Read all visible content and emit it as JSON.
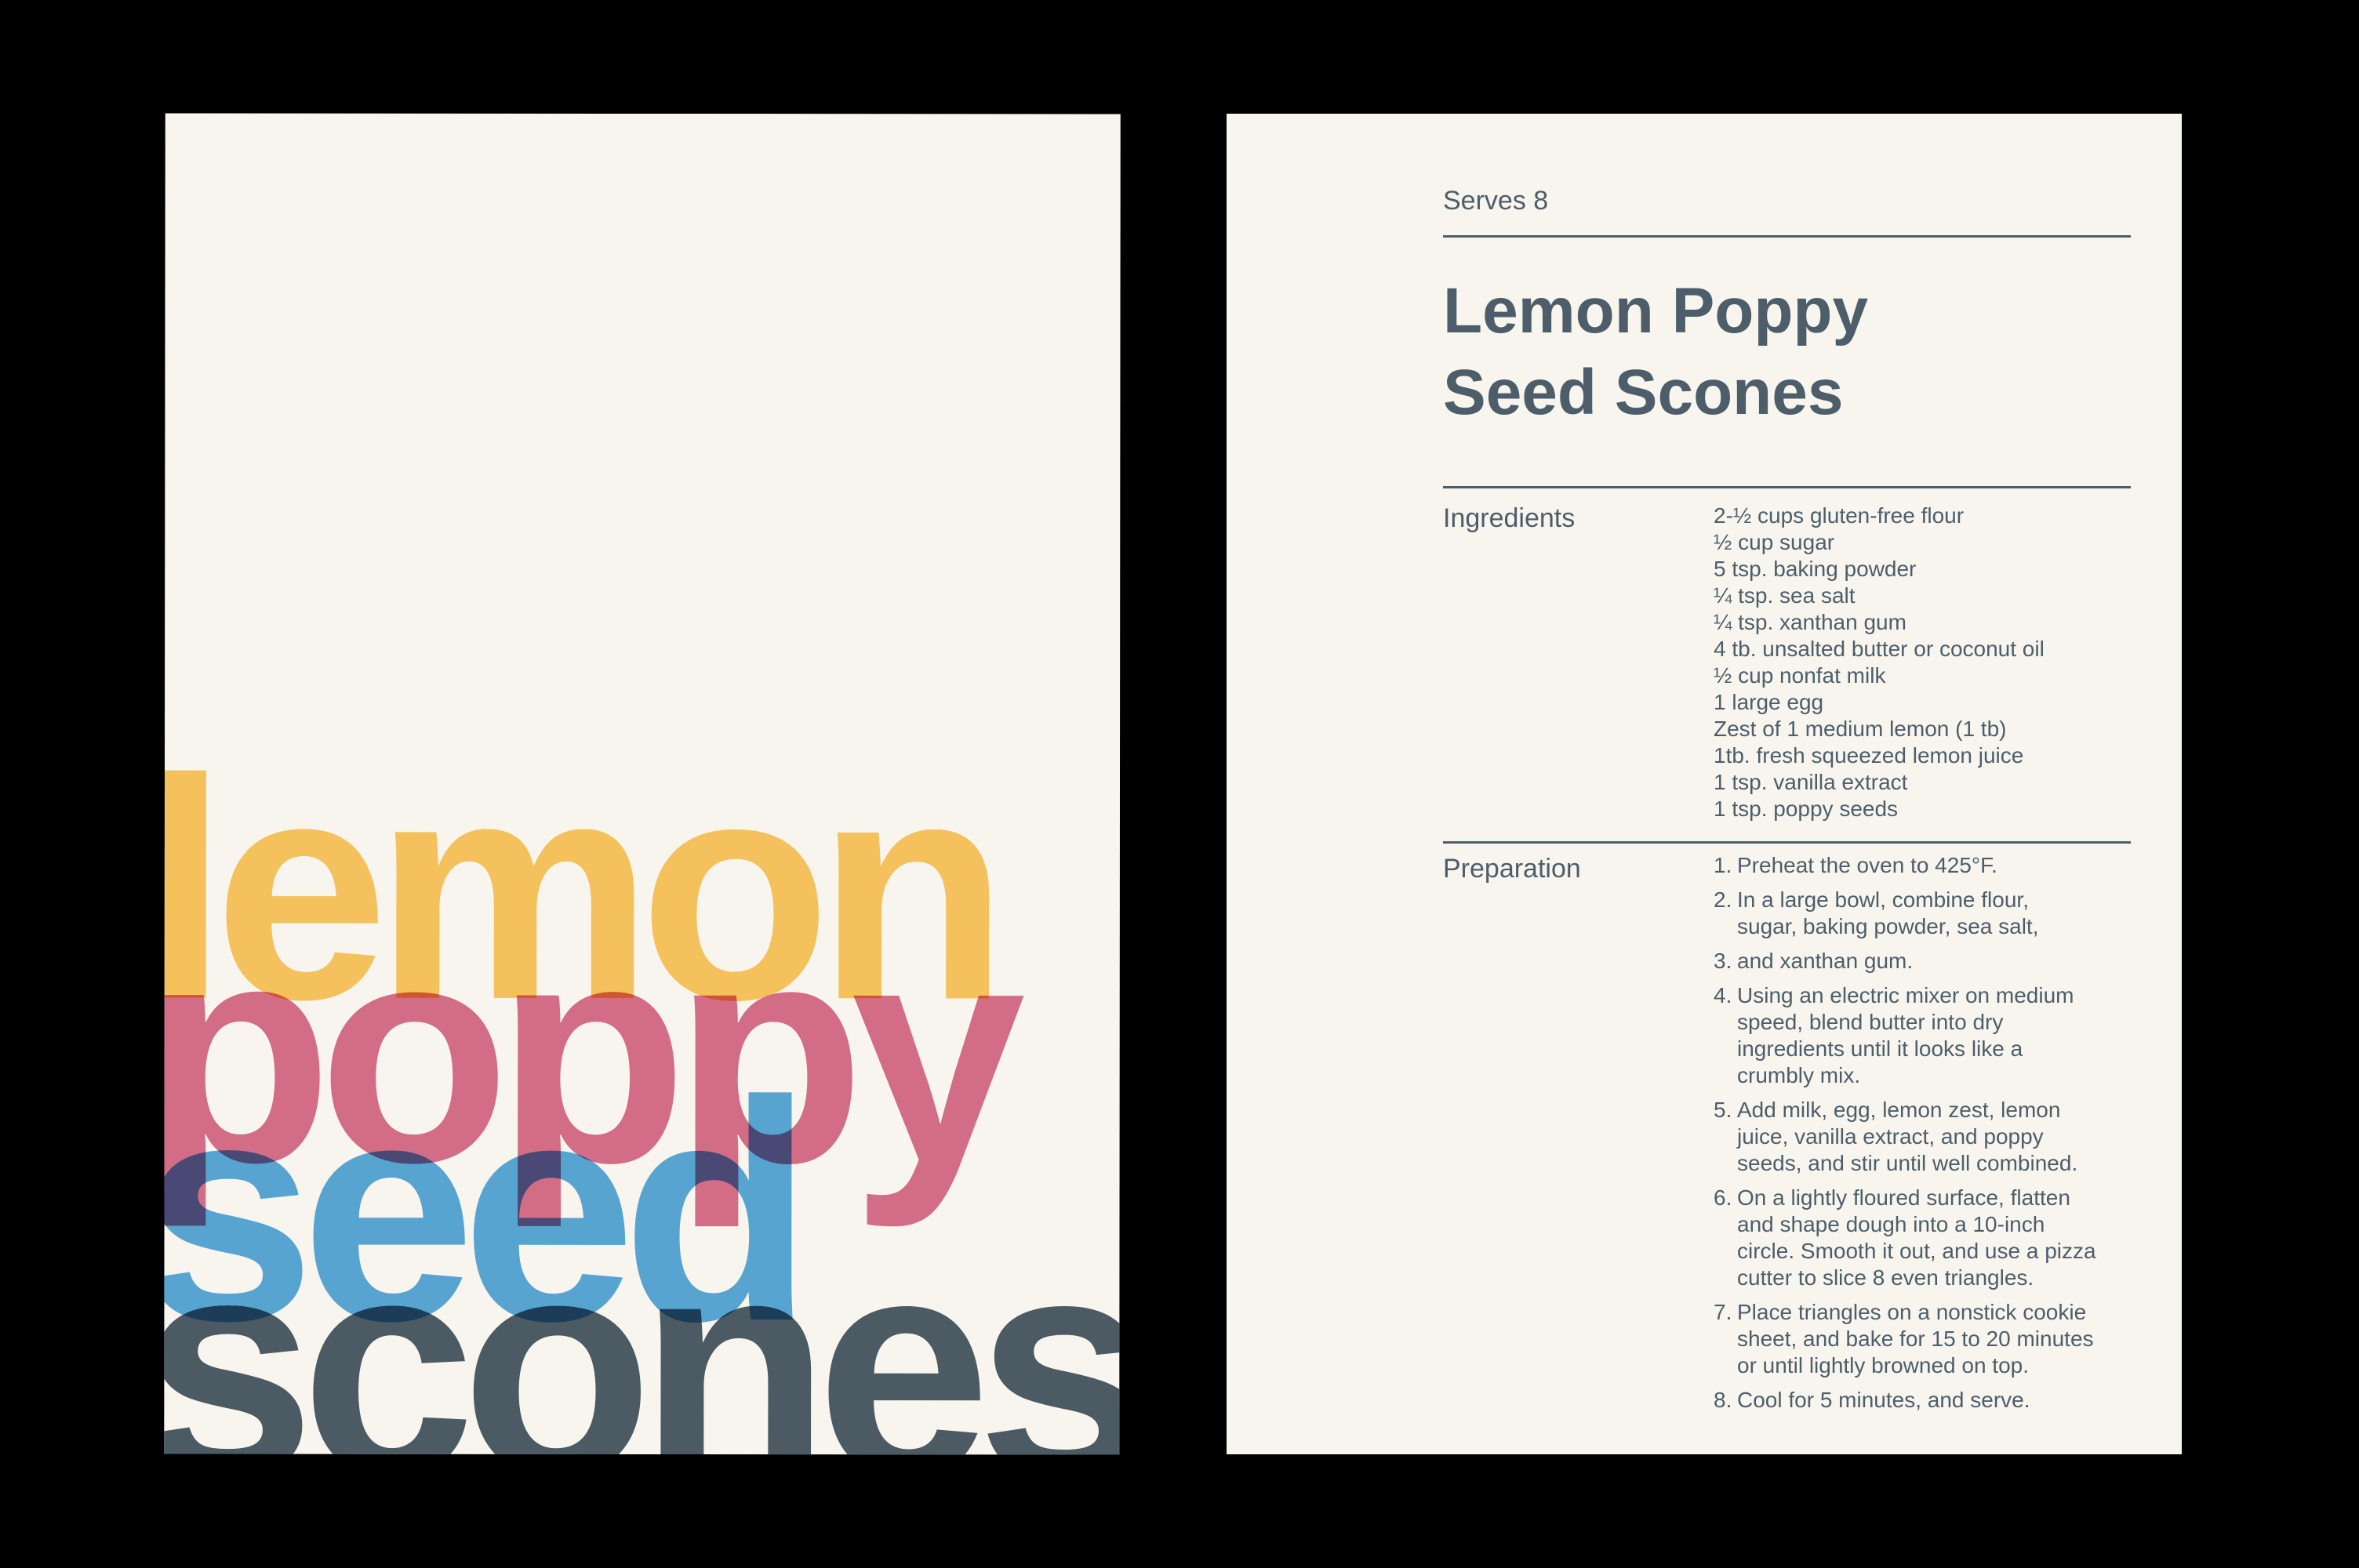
{
  "colors": {
    "background": "#000000",
    "paper": "#f7f5ee",
    "ink": "#4d5e6a",
    "lemon": "#fcc964",
    "poppy": "#d9718e",
    "seed": "#5aabe0",
    "scones": "#4d5e6a"
  },
  "cover": {
    "words": [
      "lemon",
      "poppy",
      "seed",
      "scones"
    ]
  },
  "recipe": {
    "serves": "Serves 8",
    "title_line1": "Lemon Poppy",
    "title_line2": "Seed Scones",
    "ingredients_label": "Ingredients",
    "ingredients": [
      "2-½ cups gluten-free flour",
      "½ cup sugar",
      "5 tsp. baking powder",
      "¼ tsp. sea salt",
      "¼ tsp. xanthan gum",
      "4 tb. unsalted butter or coconut oil",
      "½ cup nonfat milk",
      "1 large egg",
      "Zest of 1 medium lemon (1 tb)",
      "1tb. fresh squeezed lemon juice",
      "1 tsp. vanilla extract",
      "1 tsp. poppy seeds"
    ],
    "preparation_label": "Preparation",
    "steps": [
      {
        "num": "1.",
        "text": "Preheat the oven to 425°F."
      },
      {
        "num": "2.",
        "text": "In a large bowl, combine flour,\nsugar, baking powder, sea salt,"
      },
      {
        "num": "3.",
        "text": "and xanthan gum."
      },
      {
        "num": "4.",
        "text": "Using an electric mixer on medium\nspeed, blend butter into dry\ningredients until it looks like a\ncrumbly mix."
      },
      {
        "num": "5.",
        "text": "Add milk, egg, lemon zest, lemon\njuice, vanilla extract, and poppy\nseeds, and stir until well combined."
      },
      {
        "num": "6.",
        "text": "On a lightly floured surface, flatten\nand shape dough into a 10-inch\ncircle. Smooth it out, and use a pizza\ncutter to slice 8 even triangles."
      },
      {
        "num": "7.",
        "text": "Place triangles on a nonstick cookie\nsheet, and bake for 15 to 20 minutes\nor until lightly browned on top."
      },
      {
        "num": "8.",
        "text": "Cool for 5 minutes, and serve."
      }
    ]
  }
}
